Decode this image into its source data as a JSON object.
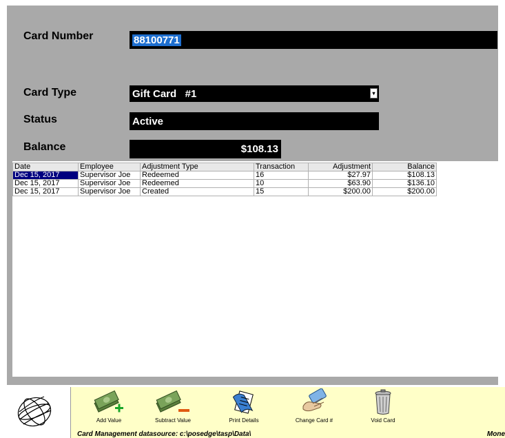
{
  "form": {
    "card_number_label": "Card Number",
    "card_number_value": "88100771",
    "card_type_label": "Card Type",
    "card_type_value": "Gift Card   #1",
    "status_label": "Status",
    "status_value": "Active",
    "balance_label": "Balance",
    "balance_value": "$108.13"
  },
  "history": {
    "columns": [
      "Date",
      "Employee",
      "Adjustment Type",
      "Transaction",
      "Adjustment",
      "Balance"
    ],
    "rows": [
      {
        "date": "Dec 15, 2017",
        "employee": "Supervisor Joe",
        "type": "Redeemed",
        "transaction": "16",
        "adjustment": "$27.97",
        "balance": "$108.13"
      },
      {
        "date": "Dec 15, 2017",
        "employee": "Supervisor Joe",
        "type": "Redeemed",
        "transaction": "10",
        "adjustment": "$63.90",
        "balance": "$136.10"
      },
      {
        "date": "Dec 15, 2017",
        "employee": "Supervisor Joe",
        "type": "Created",
        "transaction": "15",
        "adjustment": "$200.00",
        "balance": "$200.00"
      }
    ]
  },
  "toolbar": {
    "add_value": "Add Value",
    "subtract_value": "Subtract Value",
    "print_details": "Print Details",
    "change_card": "Change Card #",
    "void_card": "Void Card"
  },
  "status_bar": {
    "left_text": "Card Management  datasource: c:\\posedge\\tasp\\Data\\",
    "right_text": "Mone"
  },
  "icons": {
    "logo": "globe-icon",
    "add_value": "money-plus-icon",
    "subtract_value": "money-minus-icon",
    "print_details": "print-icon",
    "change_card": "hand-card-icon",
    "void_card": "trash-can-icon"
  },
  "colors": {
    "panel_bg": "#a9a9a9",
    "field_bg": "#000000",
    "selection": "#1e6fd0",
    "row_selected": "#00007f",
    "toolbar_bg": "#ffffc8"
  }
}
